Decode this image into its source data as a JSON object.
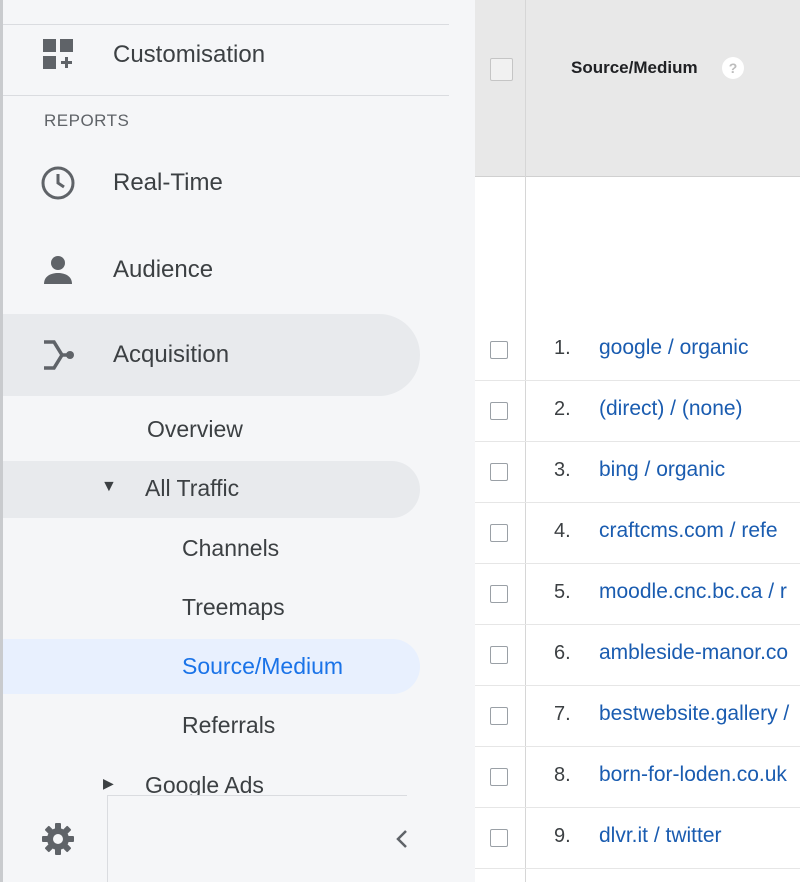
{
  "sidebar": {
    "customisation_label": "Customisation",
    "reports_heading": "REPORTS",
    "items": [
      {
        "label": "Real-Time",
        "icon": "clock-icon"
      },
      {
        "label": "Audience",
        "icon": "person-icon"
      },
      {
        "label": "Acquisition",
        "icon": "acquisition-icon"
      }
    ],
    "acquisition_children": {
      "overview": "Overview",
      "all_traffic": "All Traffic",
      "all_traffic_children": [
        "Channels",
        "Treemaps",
        "Source/Medium",
        "Referrals"
      ],
      "google_ads": "Google Ads"
    },
    "active_item": "Source/Medium",
    "colors": {
      "active_text": "#1a73e8",
      "active_bg": "#e8f0fe",
      "hover_bg": "#e8eaed"
    }
  },
  "table": {
    "column_title": "Source/Medium",
    "help_icon": "?",
    "rows": [
      {
        "num": "1.",
        "source": "google / organic"
      },
      {
        "num": "2.",
        "source": "(direct) / (none)"
      },
      {
        "num": "3.",
        "source": "bing / organic"
      },
      {
        "num": "4.",
        "source": "craftcms.com / refe"
      },
      {
        "num": "5.",
        "source": "moodle.cnc.bc.ca / r"
      },
      {
        "num": "6.",
        "source": "ambleside-manor.co"
      },
      {
        "num": "7.",
        "source": "bestwebsite.gallery /"
      },
      {
        "num": "8.",
        "source": "born-for-loden.co.uk"
      },
      {
        "num": "9.",
        "source": "dlvr.it / twitter"
      }
    ]
  }
}
